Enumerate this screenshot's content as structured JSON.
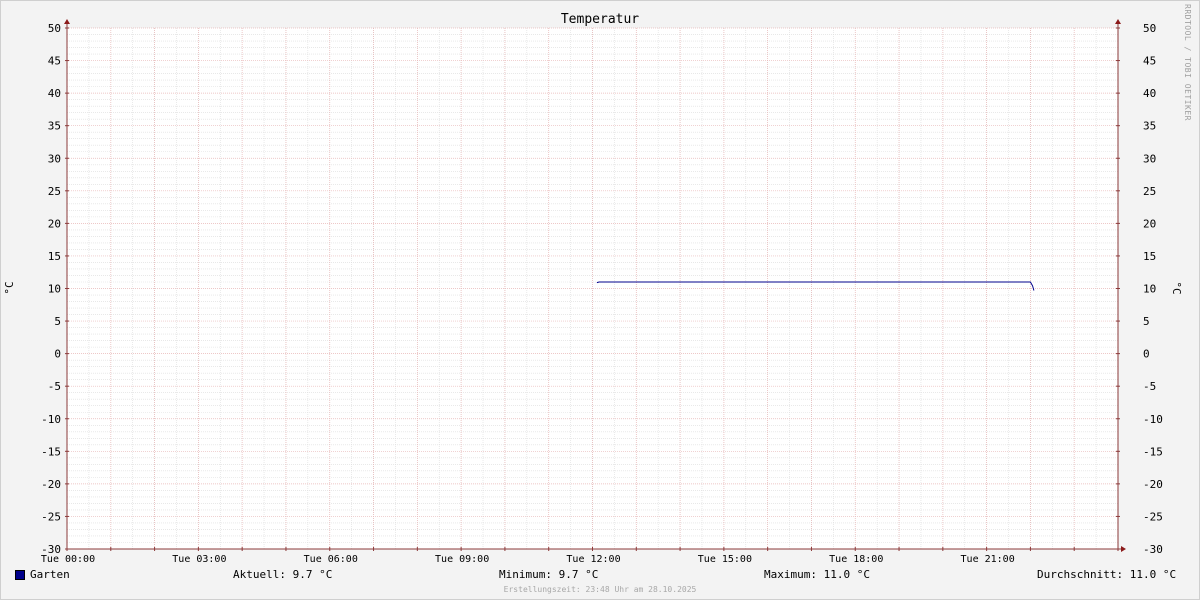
{
  "chart_data": {
    "type": "line",
    "title": "Temperatur",
    "ylabel": "°C",
    "ylabel_right": "°C",
    "ylim": [
      -30,
      50
    ],
    "y_ticks": [
      -30,
      -25,
      -20,
      -15,
      -10,
      -5,
      0,
      5,
      10,
      15,
      20,
      25,
      30,
      35,
      40,
      45,
      50
    ],
    "x_range_hours": [
      0,
      24
    ],
    "x_tick_labels": [
      "Tue 00:00",
      "Tue 03:00",
      "Tue 06:00",
      "Tue 09:00",
      "Tue 12:00",
      "Tue 15:00",
      "Tue 18:00",
      "Tue 21:00"
    ],
    "x_tick_hours": [
      0,
      3,
      6,
      9,
      12,
      15,
      18,
      21
    ],
    "grid": true,
    "series": [
      {
        "name": "Garten",
        "color": "#00008b",
        "points": [
          [
            12.1,
            10.9
          ],
          [
            12.15,
            11.0
          ],
          [
            22.0,
            11.0
          ],
          [
            22.05,
            10.4
          ],
          [
            22.08,
            9.7
          ]
        ]
      }
    ]
  },
  "legend": {
    "series_name": "Garten",
    "current": "Aktuell: 9.7 °C",
    "minimum": "Minimum: 9.7 °C",
    "maximum": "Maximum: 11.0 °C",
    "average": "Durchschnitt: 11.0 °C"
  },
  "footer": "Erstellungszeit: 23:48 Uhr am 28.10.2025",
  "watermark": "RRDTOOL / TOBI OETIKER"
}
